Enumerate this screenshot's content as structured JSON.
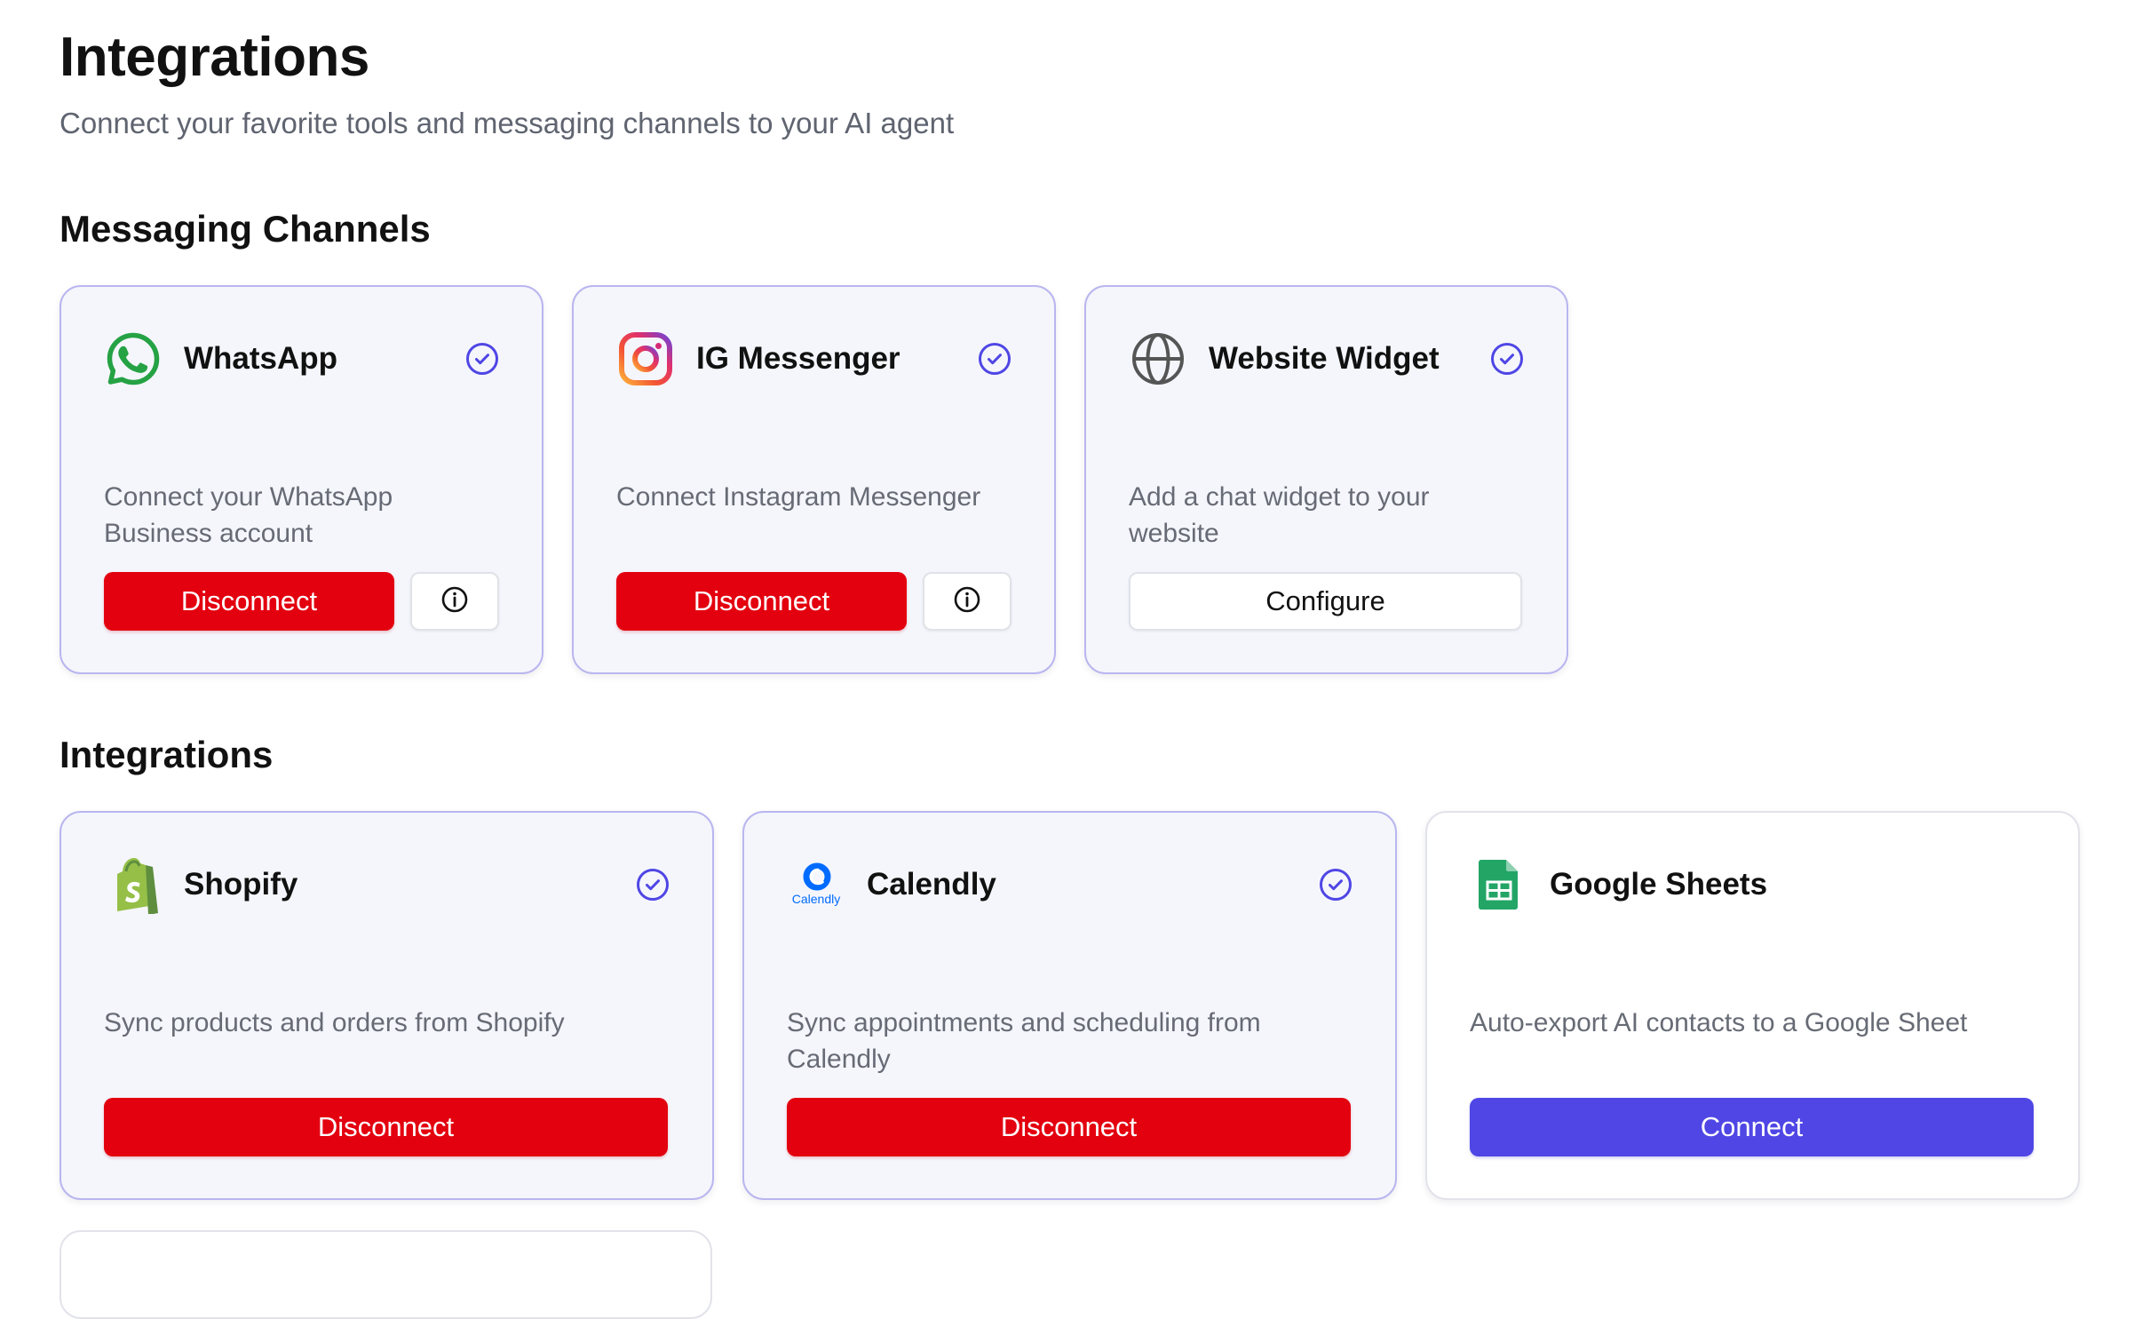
{
  "header": {
    "title": "Integrations",
    "subtitle": "Connect your favorite tools and messaging channels to your AI agent"
  },
  "messaging": {
    "title": "Messaging Channels",
    "cards": [
      {
        "name": "WhatsApp",
        "icon": "whatsapp-icon",
        "connected": true,
        "description": "Connect your WhatsApp Business account",
        "action": "Disconnect"
      },
      {
        "name": "IG Messenger",
        "icon": "instagram-icon",
        "connected": true,
        "description": "Connect Instagram Messenger",
        "action": "Disconnect"
      },
      {
        "name": "Website Widget",
        "icon": "globe-icon",
        "connected": true,
        "description": "Add a chat widget to your website",
        "action": "Configure"
      }
    ]
  },
  "integrations": {
    "title": "Integrations",
    "cards": [
      {
        "name": "Shopify",
        "icon": "shopify-icon",
        "connected": true,
        "description": "Sync products and orders from Shopify",
        "action": "Disconnect"
      },
      {
        "name": "Calendly",
        "icon": "calendly-icon",
        "logo_text": "Calendly",
        "connected": true,
        "description": "Sync appointments and scheduling from Calendly",
        "action": "Disconnect"
      },
      {
        "name": "Google Sheets",
        "icon": "google-sheets-icon",
        "connected": false,
        "description": "Auto-export AI contacts to a Google Sheet",
        "action": "Connect"
      }
    ]
  },
  "icons": {
    "connected": "check-circle-icon",
    "info": "info-icon"
  },
  "colors": {
    "danger": "#e3000f",
    "primary": "#4f46e5",
    "accent_check": "#4f46e5",
    "whatsapp": "#25a244",
    "shopify": "#95bf47",
    "calendly": "#006bff",
    "google_sheets": "#23a566"
  }
}
